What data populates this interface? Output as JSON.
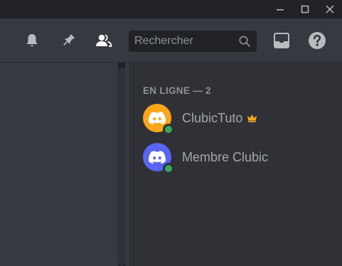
{
  "window": {
    "controls": [
      "minimize-icon",
      "maximize-icon",
      "close-icon"
    ]
  },
  "header": {
    "icons": [
      "bell-icon",
      "pin-icon",
      "members-icon",
      "inbox-icon",
      "help-icon"
    ],
    "search": {
      "placeholder": "Rechercher",
      "value": ""
    }
  },
  "members": {
    "section_label": "EN LIGNE — 2",
    "list": [
      {
        "name": "ClubicTuto",
        "avatar_color": "#faa61a",
        "status_color": "#3ba55c",
        "owner": true,
        "badge_icon": "crown-icon",
        "badge_color": "#faa61a"
      },
      {
        "name": "Membre Clubic",
        "avatar_color": "#5865f2",
        "status_color": "#3ba55c",
        "owner": false
      }
    ]
  },
  "colors": {
    "header_bg": "#36393f",
    "member_list_bg": "#2f3136",
    "titlebar_bg": "#202225",
    "icon_color": "#b9bbbe",
    "text_muted": "#8e9297"
  }
}
